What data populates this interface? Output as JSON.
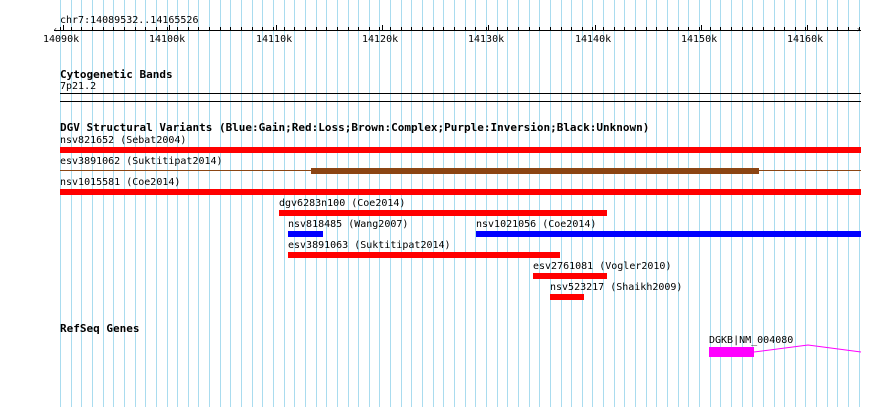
{
  "browser": {
    "location": "chr7:14089532..14165526",
    "scale_ticks": [
      "14090k",
      "14100k",
      "14110k",
      "14120k",
      "14130k",
      "14140k",
      "14150k",
      "14160k"
    ]
  },
  "tracks": {
    "cytoband": {
      "title": "Cytogenetic Bands",
      "band": "7p21.2"
    },
    "dgv": {
      "title": "DGV Structural Variants (Blue:Gain;Red:Loss;Brown:Complex;Purple:Inversion;Black:Unknown)",
      "features": [
        {
          "label": "nsv821652 (Sebat2004)",
          "type": "Loss",
          "color": "#ff0000"
        },
        {
          "label": "esv3891062 (Suktitipat2014)",
          "type": "Complex",
          "color": "#8b4513"
        },
        {
          "label": "nsv1015581 (Coe2014)",
          "type": "Loss",
          "color": "#ff0000"
        },
        {
          "label": "dgv6283n100 (Coe2014)",
          "type": "Loss",
          "color": "#ff0000"
        },
        {
          "label": "nsv818485 (Wang2007)",
          "type": "Gain",
          "color": "#0000ff"
        },
        {
          "label": "nsv1021056 (Coe2014)",
          "type": "Gain",
          "color": "#0000ff"
        },
        {
          "label": "esv3891063 (Suktitipat2014)",
          "type": "Loss",
          "color": "#ff0000"
        },
        {
          "label": "esv2761081 (Vogler2010)",
          "type": "Loss",
          "color": "#ff0000"
        },
        {
          "label": "nsv523217 (Shaikh2009)",
          "type": "Loss",
          "color": "#ff0000"
        }
      ]
    },
    "refseq": {
      "title": "RefSeq Genes",
      "gene": "DGKB|NM_004080",
      "color": "#ff00ff"
    }
  }
}
